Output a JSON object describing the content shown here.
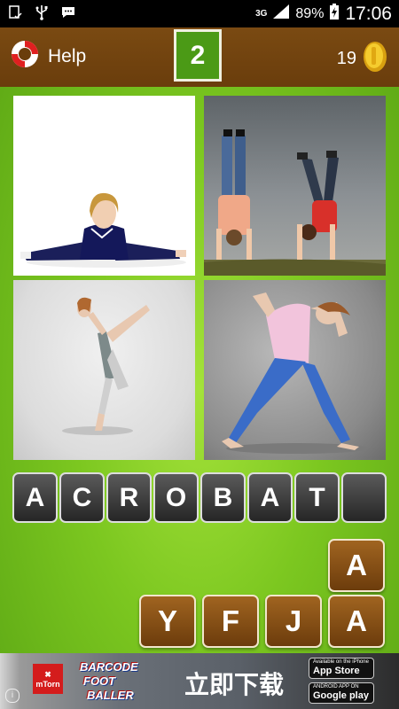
{
  "status_bar": {
    "network": "3G",
    "battery": "89%",
    "time": "17:06"
  },
  "header": {
    "help_label": "Help",
    "level": "2",
    "coins": "19"
  },
  "puzzle": {
    "answer_slots": [
      "A",
      "C",
      "R",
      "O",
      "B",
      "A",
      "T",
      ""
    ],
    "choice_letters": [
      "A",
      "Y",
      "F",
      "J",
      "A"
    ]
  },
  "ad": {
    "logo_text": "mTorn",
    "game_title_line1": "BARCODE",
    "game_title_line2": "FOOT",
    "game_title_line3": "BALLER",
    "cta": "立即下载",
    "app_store_small": "Available on the iPhone",
    "app_store_label": "App Store",
    "google_play_small": "ANDROID APP ON",
    "google_play_label": "Google play",
    "info_icon": "i"
  }
}
